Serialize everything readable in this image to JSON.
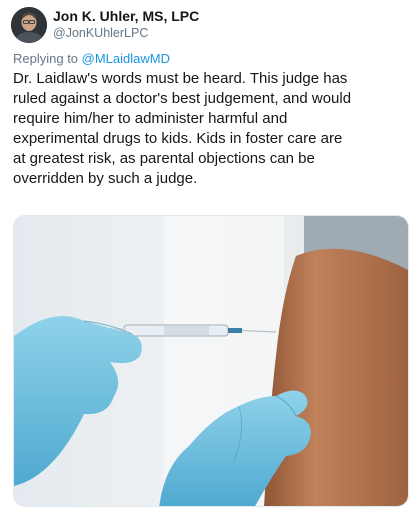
{
  "tweet": {
    "author": {
      "display_name": "Jon K. Uhler, MS, LPC",
      "handle": "@JonKUhlerLPC"
    },
    "reply": {
      "prefix": "Replying to ",
      "mention": "@MLaidlawMD"
    },
    "text": "Dr. Laidlaw's words must be heard. This judge has\nruled against a doctor's best judgement, and would\nrequire him/her to administer harmful and\nexperimental drugs to kids. Kids in foster care are\nat greatest risk, as parental objections can be\noverridden by such a  judge.",
    "media": {
      "kind": "photo",
      "glove_color": "#6ec3e0",
      "skin_color": "#b9794f",
      "shirt_color": "#9ea9b2"
    }
  },
  "colors": {
    "text": "#14171a",
    "secondary": "#657786",
    "link": "#1b95e0"
  },
  "icons": [
    "avatar-icon"
  ]
}
